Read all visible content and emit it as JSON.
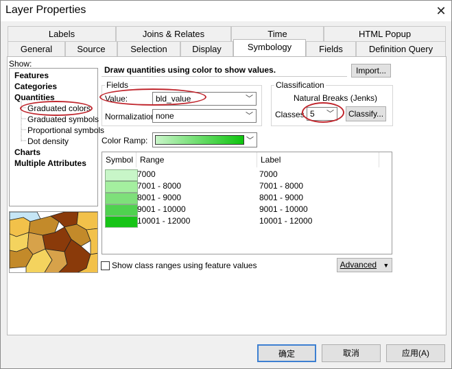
{
  "window": {
    "title": "Layer Properties",
    "close_glyph": "✕"
  },
  "tabs_row1": [
    {
      "label": "Labels"
    },
    {
      "label": "Joins & Relates"
    },
    {
      "label": "Time"
    },
    {
      "label": "HTML Popup"
    }
  ],
  "tabs_row2": [
    {
      "label": "General"
    },
    {
      "label": "Source"
    },
    {
      "label": "Selection"
    },
    {
      "label": "Display"
    },
    {
      "label": "Symbology"
    },
    {
      "label": "Fields"
    },
    {
      "label": "Definition Query"
    }
  ],
  "show": {
    "label": "Show:",
    "items": [
      {
        "label": "Features"
      },
      {
        "label": "Categories"
      },
      {
        "label": "Quantities"
      },
      {
        "label": "Graduated colors"
      },
      {
        "label": "Graduated symbols"
      },
      {
        "label": "Proportional symbols"
      },
      {
        "label": "Dot density"
      },
      {
        "label": "Charts"
      },
      {
        "label": "Multiple Attributes"
      }
    ]
  },
  "description": "Draw quantities using color to show values.",
  "import_label": "Import...",
  "fields": {
    "title": "Fields",
    "value_label": "Value:",
    "value": "bld_value",
    "normalization_label": "Normalization:",
    "normalization": "none"
  },
  "classification": {
    "title": "Classification",
    "method": "Natural Breaks (Jenks)",
    "classes_label": "Classes",
    "classes": "5",
    "classify_label": "Classify..."
  },
  "color_ramp": {
    "label": "Color Ramp:",
    "start_color": "#c9f5c9",
    "end_color": "#0ec40e"
  },
  "table": {
    "headers": {
      "symbol": "Symbol",
      "range": "Range",
      "label": "Label"
    },
    "rows": [
      {
        "color": "#c8f6c8",
        "range": "7000",
        "label": "7000"
      },
      {
        "color": "#a4ef9f",
        "range": "7001 - 8000",
        "label": "7001 - 8000"
      },
      {
        "color": "#7ee07a",
        "range": "8001 - 9000",
        "label": "8001 - 9000"
      },
      {
        "color": "#4fd24f",
        "range": "9001 - 10000",
        "label": "9001 - 10000"
      },
      {
        "color": "#16c416",
        "range": "10001 - 12000",
        "label": "10001 - 12000"
      }
    ]
  },
  "show_class_ranges_label": "Show class ranges using feature values",
  "advanced_label": "Advanced",
  "buttons": {
    "ok": "确定",
    "cancel": "取消",
    "apply": "应用(A)"
  },
  "highlight_color": "#c0262d"
}
